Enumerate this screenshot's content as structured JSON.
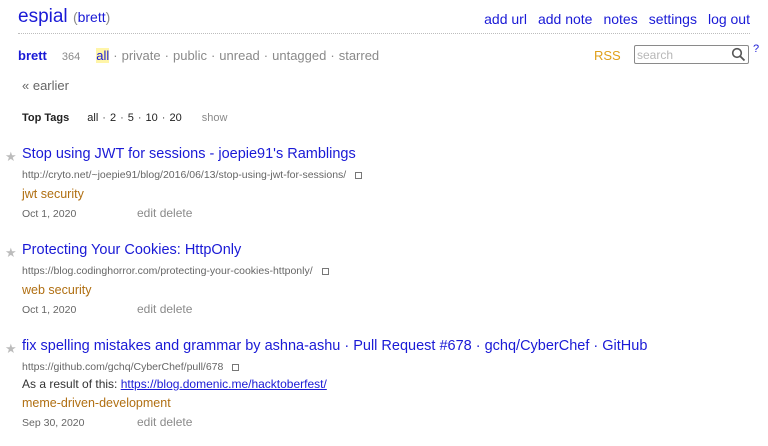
{
  "header": {
    "brand": "espial",
    "user_open": "(",
    "user": "brett",
    "user_close": ")",
    "nav": [
      "add url",
      "add note",
      "notes",
      "settings",
      "log out"
    ]
  },
  "filters": {
    "username": "brett",
    "count": "364",
    "tabs": [
      "all",
      "private",
      "public",
      "unread",
      "untagged",
      "starred"
    ],
    "active_tab": "all",
    "rss": "RSS",
    "search_placeholder": "search",
    "help": "?"
  },
  "earlier": "« earlier",
  "top_tags": {
    "label": "Top Tags",
    "options": [
      "all",
      "2",
      "5",
      "10",
      "20"
    ],
    "show": "show"
  },
  "bookmarks": [
    {
      "title": "Stop using JWT for sessions - joepie91's Ramblings",
      "url": "http://cryto.net/~joepie91/blog/2016/06/13/stop-using-jwt-for-sessions/",
      "description_prefix": "",
      "description_link": "",
      "tags": [
        "jwt",
        "security"
      ],
      "date": "Oct 1, 2020",
      "edit": "edit",
      "delete": "delete"
    },
    {
      "title": "Protecting Your Cookies: HttpOnly",
      "url": "https://blog.codinghorror.com/protecting-your-cookies-httponly/",
      "description_prefix": "",
      "description_link": "",
      "tags": [
        "web",
        "security"
      ],
      "date": "Oct 1, 2020",
      "edit": "edit",
      "delete": "delete"
    },
    {
      "title": "fix spelling mistakes and grammar by ashna-ashu · Pull Request #678 · gchq/CyberChef · GitHub",
      "url": "https://github.com/gchq/CyberChef/pull/678",
      "description_prefix": "As a result of this: ",
      "description_link": "https://blog.domenic.me/hacktoberfest/",
      "tags": [
        "meme-driven-development"
      ],
      "date": "Sep 30, 2020",
      "edit": "edit",
      "delete": "delete"
    }
  ],
  "colors": {
    "link": "#1a1ad6",
    "tag": "#b06f12",
    "muted": "#8a8a8a",
    "rss": "#e0a01a",
    "active_highlight": "#fff5a8"
  }
}
